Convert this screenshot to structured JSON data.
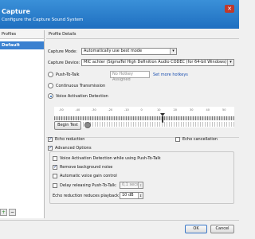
{
  "window": {
    "title": "Capture",
    "subtitle": "Configure the Capture Sound System"
  },
  "profiles": {
    "header": "Profiles",
    "items": [
      "Default"
    ]
  },
  "details": {
    "header": "Profile Details",
    "capture_mode_label": "Capture Mode:",
    "capture_mode_value": "Automatically use best mode",
    "capture_device_label": "Capture Device:",
    "capture_device_value": "MIC achter (SigmaTel High Definition Audio CODEC (for 64-bit Windows))",
    "push_to_talk_label": "Push-To-Talk",
    "hotkey_placeholder": "No Hotkey Assigned",
    "set_hotkeys_link": "Set more hotkeys",
    "continuous_label": "Continuous Transmission",
    "vad_label": "Voice Activation Detection",
    "meter_ticks": [
      "-50",
      "-40",
      "-30",
      "-20",
      "-10",
      "0",
      "10",
      "20",
      "30",
      "40",
      "50"
    ],
    "begin_test_label": "Begin Test",
    "echo_reduction_label": "Echo reduction",
    "echo_cancellation_label": "Echo cancellation",
    "advanced_options_label": "Advanced Options",
    "vad_while_ptt_label": "Voice Activation Detection while using Push-To-Talk",
    "remove_noise_label": "Remove background noise",
    "auto_gain_label": "Automatic voice gain control",
    "delay_release_label": "Delay releasing Push-To-Talk:",
    "delay_value": "0,1 secs",
    "echo_reduce_playback_label": "Echo reduction reduces playback by:",
    "echo_reduce_value": "10 dB"
  },
  "states": {
    "mode": "vad",
    "echo_reduction": true,
    "echo_cancellation": false,
    "advanced_options": true,
    "vad_while_ptt": false,
    "remove_noise": true,
    "auto_gain": false,
    "delay_release": false
  },
  "footer": {
    "ok_label": "OK",
    "cancel_label": "Cancel"
  },
  "colors": {
    "titlebar": "#1f6fc0",
    "selection": "#3a80d0",
    "link": "#1a4fb0"
  }
}
